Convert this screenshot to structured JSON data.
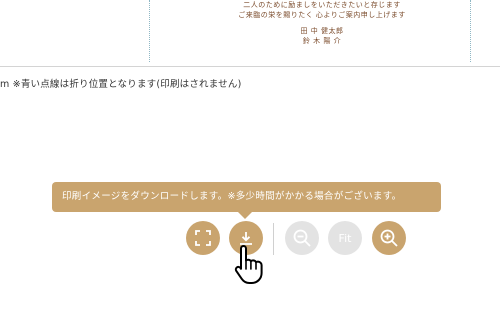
{
  "invitation": {
    "line1": "二人のために励ましをいただきたいと存じます",
    "line2": "ご来臨の栄を賜りたく 心よりご案内申し上げます",
    "name1": "田 中 健太郎",
    "name2": "鈴 木 陽 介"
  },
  "note": "m ※青い点線は折り位置となります(印刷はされません)",
  "tooltip": "印刷イメージをダウンロードします。※多少時間がかかる場合がございます。",
  "toolbar": {
    "fit_label": "Fit"
  },
  "colors": {
    "accent": "#c9a46e",
    "disabled": "#e3e3e3",
    "fold_line": "#8fb7c4"
  },
  "icons": [
    "fullscreen-icon",
    "download-icon",
    "zoom-out-icon",
    "zoom-in-icon",
    "hand-pointer-icon"
  ]
}
